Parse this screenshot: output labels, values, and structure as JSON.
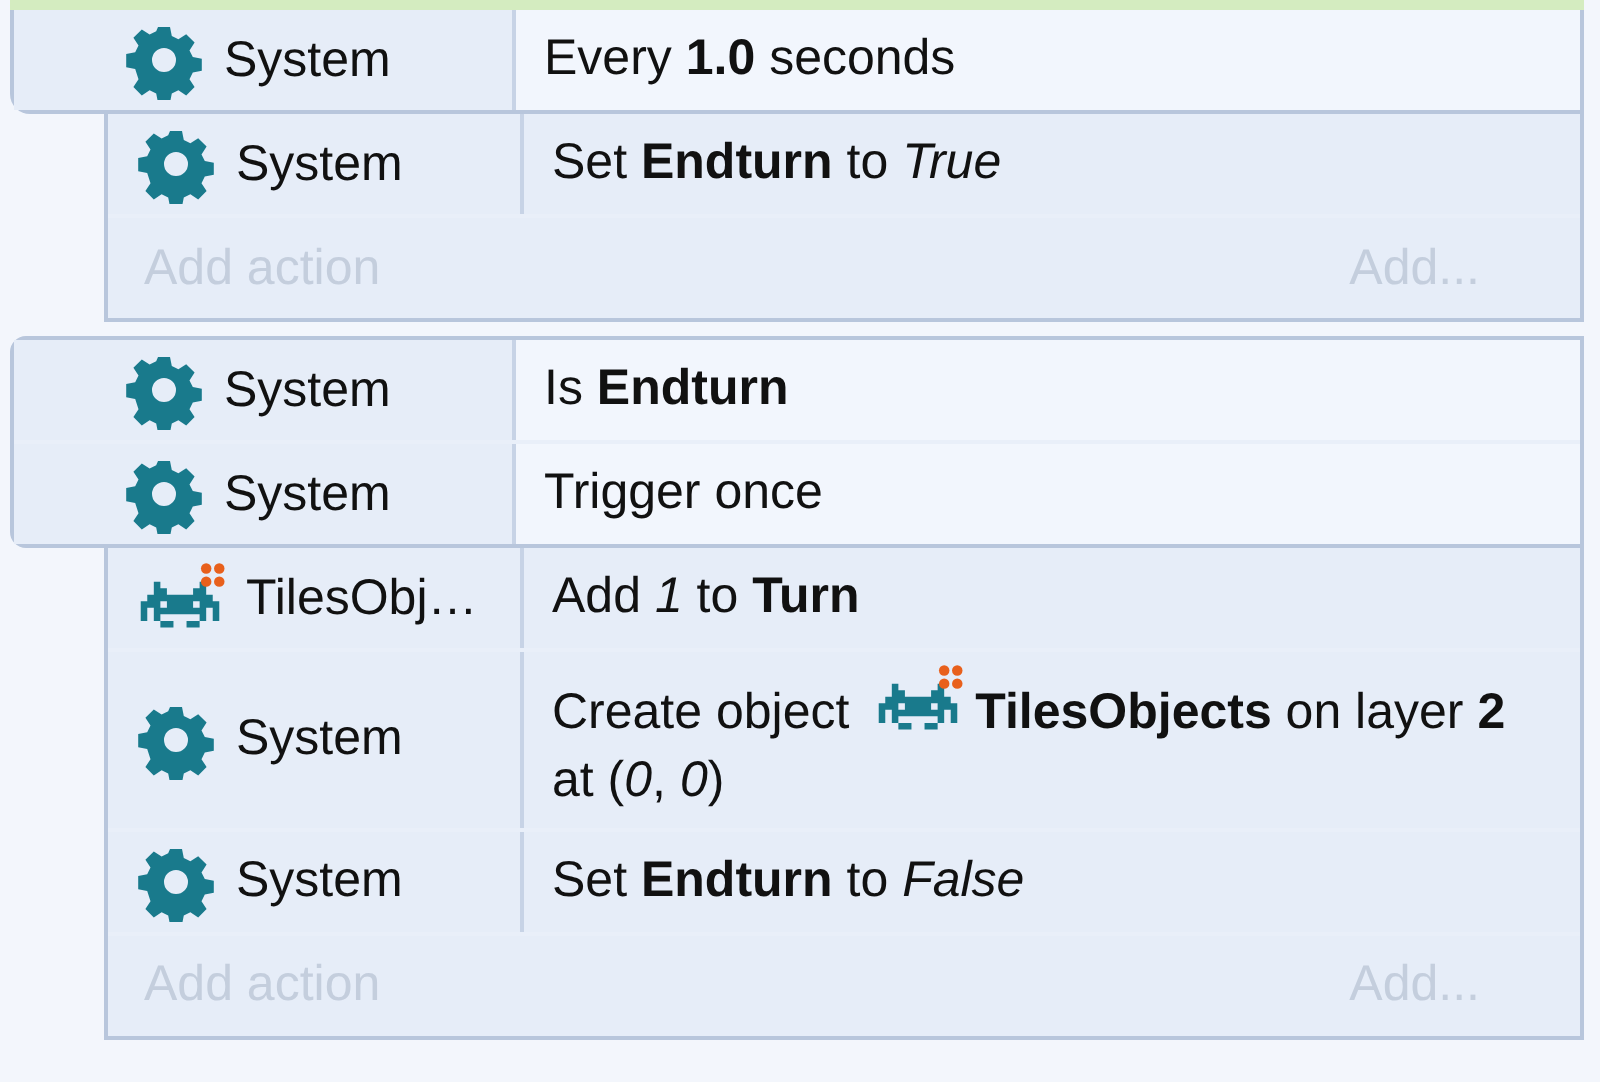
{
  "events": [
    {
      "conditions": [
        {
          "object": {
            "kind": "system",
            "name": "System"
          },
          "parts": [
            {
              "kind": "text",
              "text": "Every **1.0** seconds"
            }
          ]
        }
      ],
      "actions": [
        {
          "object": {
            "kind": "system",
            "name": "System"
          },
          "parts": [
            {
              "kind": "text",
              "text": "Set **Endturn** to *True*"
            }
          ]
        }
      ],
      "add_action": {
        "label": "Add action",
        "button": "Add..."
      }
    },
    {
      "conditions": [
        {
          "object": {
            "kind": "system",
            "name": "System"
          },
          "parts": [
            {
              "kind": "text",
              "text": "Is **Endturn**"
            }
          ]
        },
        {
          "object": {
            "kind": "system",
            "name": "System"
          },
          "parts": [
            {
              "kind": "text",
              "text": "Trigger once"
            }
          ]
        }
      ],
      "actions": [
        {
          "object": {
            "kind": "sprite",
            "name": "TilesObj…"
          },
          "parts": [
            {
              "kind": "text",
              "text": "Add *1* to **Turn**"
            }
          ]
        },
        {
          "object": {
            "kind": "system",
            "name": "System"
          },
          "parts": [
            {
              "kind": "text",
              "text": "Create object "
            },
            {
              "kind": "sprite"
            },
            {
              "kind": "text",
              "text": "**TilesObjects** on layer **2** at (*0*, *0*)"
            }
          ]
        },
        {
          "object": {
            "kind": "system",
            "name": "System"
          },
          "parts": [
            {
              "kind": "text",
              "text": "Set **Endturn** to *False*"
            }
          ]
        }
      ],
      "add_action": {
        "label": "Add action",
        "button": "Add..."
      }
    }
  ]
}
